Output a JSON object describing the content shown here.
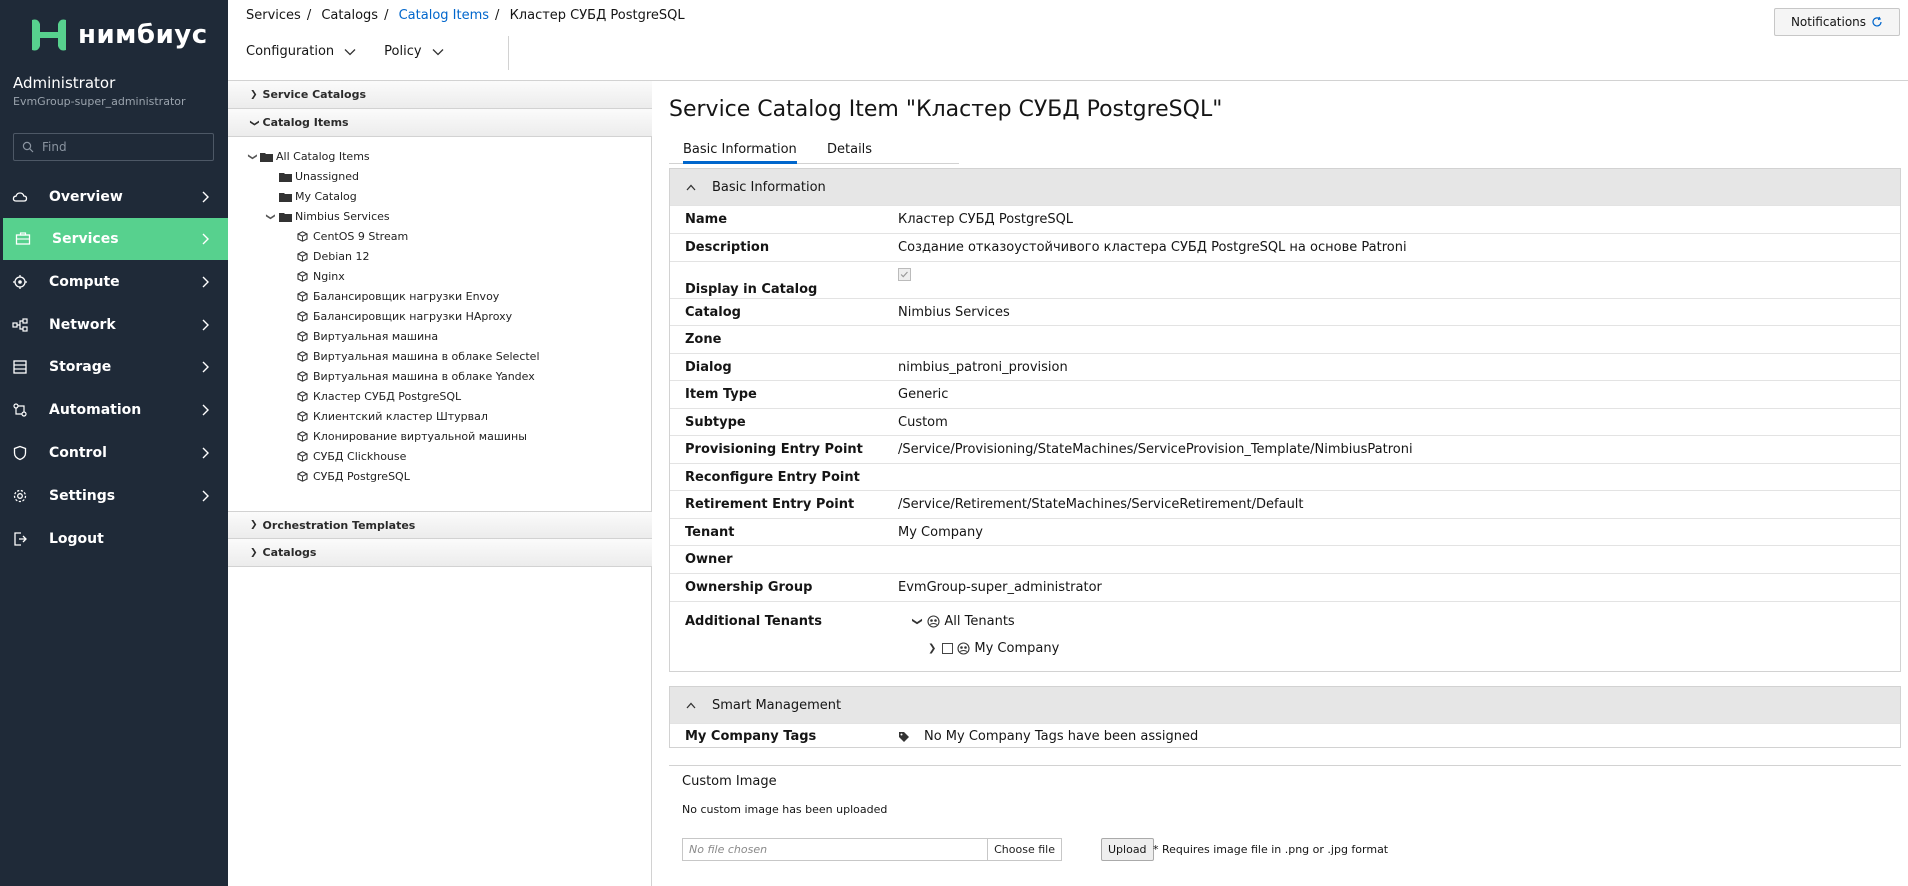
{
  "brand": {
    "name": "нимбиус",
    "color": "#57d18e"
  },
  "user": {
    "name": "Administrator",
    "group": "EvmGroup-super_administrator"
  },
  "search": {
    "placeholder": "Find"
  },
  "nav": [
    {
      "label": "Overview",
      "icon": "cloud-icon"
    },
    {
      "label": "Services",
      "icon": "services-icon",
      "active": true
    },
    {
      "label": "Compute",
      "icon": "compute-icon"
    },
    {
      "label": "Network",
      "icon": "network-icon"
    },
    {
      "label": "Storage",
      "icon": "storage-icon"
    },
    {
      "label": "Automation",
      "icon": "automation-icon"
    },
    {
      "label": "Control",
      "icon": "shield-icon"
    },
    {
      "label": "Settings",
      "icon": "gear-icon"
    },
    {
      "label": "Logout",
      "icon": "logout-icon"
    }
  ],
  "breadcrumb": [
    "Services",
    "Catalogs",
    "Catalog Items",
    "Кластер СУБД PostgreSQL"
  ],
  "toolbar": {
    "configuration": "Configuration",
    "policy": "Policy"
  },
  "notifications": {
    "label": "Notifications"
  },
  "accordion": {
    "service_catalogs": "Service Catalogs",
    "catalog_items": "Catalog Items",
    "orchestration_templates": "Orchestration Templates",
    "catalogs": "Catalogs"
  },
  "tree": {
    "root": "All Catalog Items",
    "unassigned": "Unassigned",
    "my_catalog": "My Catalog",
    "nimbius": "Nimbius Services",
    "items": [
      "CentOS 9 Stream",
      "Debian 12",
      "Nginx",
      "Балансировщик нагрузки Envoy",
      "Балансировщик нагрузки HAproxy",
      "Виртуальная машина",
      "Виртуальная машина в облаке Selectel",
      "Виртуальная машина в облаке Yandex",
      "Кластер СУБД PostgreSQL",
      "Клиентский кластер Штурвал",
      "Клонирование виртуальной машины",
      "СУБД Clickhouse",
      "СУБД PostgreSQL"
    ]
  },
  "page": {
    "title": "Service Catalog Item \"Кластер СУБД PostgreSQL\""
  },
  "tabs": {
    "basic": "Basic Information",
    "details": "Details"
  },
  "basic_info": {
    "heading": "Basic Information",
    "rows": [
      {
        "k": "Name",
        "v": "Кластер СУБД PostgreSQL"
      },
      {
        "k": "Description",
        "v": "Создание отказоустойчивого кластера СУБД PostgreSQL на основе Patroni"
      },
      {
        "k": "Display in Catalog",
        "v": ""
      },
      {
        "k": "Catalog",
        "v": "Nimbius Services"
      },
      {
        "k": "Zone",
        "v": ""
      },
      {
        "k": "Dialog",
        "v": "nimbius_patroni_provision"
      },
      {
        "k": "Item Type",
        "v": "Generic"
      },
      {
        "k": "Subtype",
        "v": "Custom"
      },
      {
        "k": "Provisioning Entry Point",
        "v": "/Service/Provisioning/StateMachines/ServiceProvision_Template/NimbiusPatroni"
      },
      {
        "k": "Reconfigure Entry Point",
        "v": ""
      },
      {
        "k": "Retirement Entry Point",
        "v": "/Service/Retirement/StateMachines/ServiceRetirement/Default"
      },
      {
        "k": "Tenant",
        "v": "My Company"
      },
      {
        "k": "Owner",
        "v": ""
      },
      {
        "k": "Ownership Group",
        "v": "EvmGroup-super_administrator"
      },
      {
        "k": "Additional Tenants",
        "v": ""
      }
    ],
    "tenants": {
      "all": "All Tenants",
      "my": "My Company"
    }
  },
  "smart": {
    "heading": "Smart Management",
    "tags_label": "My Company Tags",
    "tags_value": "No My Company Tags have been assigned"
  },
  "custom_image": {
    "title": "Custom Image",
    "status": "No custom image has been uploaded",
    "no_file": "No file chosen",
    "choose": "Choose file",
    "upload": "Upload",
    "req": "* Requires image file in .png or .jpg format"
  }
}
